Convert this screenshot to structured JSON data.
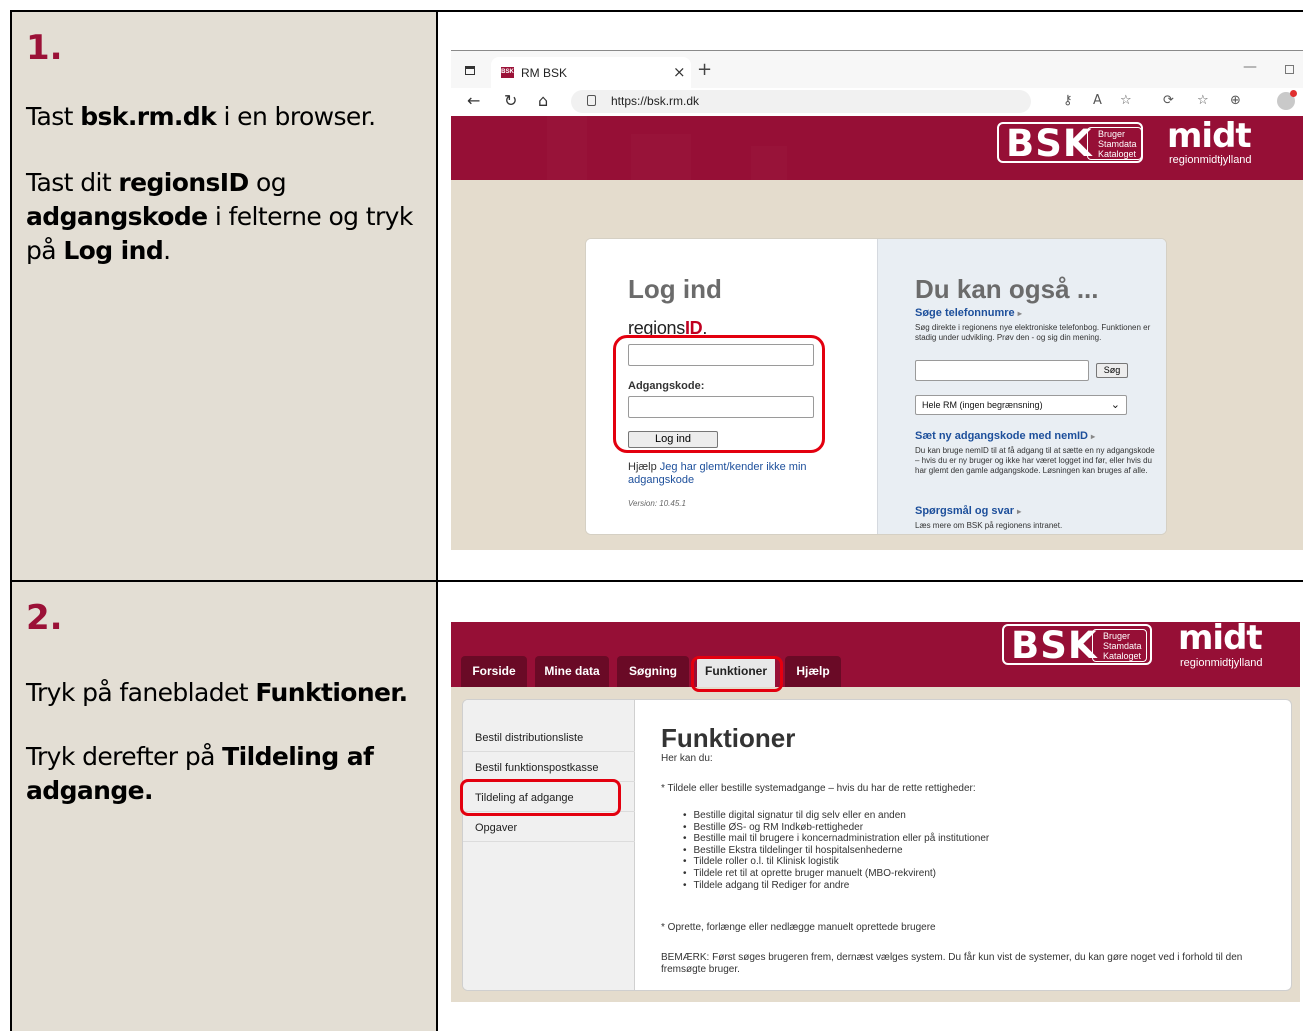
{
  "steps": [
    {
      "number": "1.",
      "paragraphs": [
        [
          {
            "t": "Tast "
          },
          {
            "t": "bsk.rm.dk",
            "b": true
          },
          {
            "t": " i en browser."
          }
        ],
        [
          {
            "t": "Tast dit "
          },
          {
            "t": "regionsID",
            "b": true
          },
          {
            "t": " og "
          },
          {
            "t": "adgangskode",
            "b": true
          },
          {
            "t": " i felterne og tryk på "
          },
          {
            "t": "Log ind",
            "b": true
          },
          {
            "t": "."
          }
        ]
      ]
    },
    {
      "number": "2.",
      "paragraphs": [
        [
          {
            "t": "Tryk på fanebladet "
          },
          {
            "t": "Funktioner.",
            "b": true
          }
        ],
        [
          {
            "t": "Tryk derefter på "
          },
          {
            "t": "Tildeling af adgange.",
            "b": true
          }
        ]
      ]
    }
  ],
  "browser": {
    "tab_title": "RM BSK",
    "favicon_text": "BSK",
    "url": "https://bsk.rm.dk",
    "close_glyph": "×",
    "newtab_glyph": "+",
    "minimize_glyph": "—"
  },
  "brand": {
    "bsk": "BSK",
    "bsk_sub": [
      "Bruger",
      "Stamdata",
      "Kataloget"
    ],
    "midt": "midt",
    "region": "regionmidtjylland",
    "colors": {
      "primary": "#960f36",
      "dark": "#6a0a26",
      "link": "#1d4f9b",
      "highlight": "#e3000f",
      "page_bg": "#e4dccd"
    }
  },
  "login": {
    "title": "Log ind",
    "regions_text": "regions",
    "regions_id": "ID",
    "regions_dot": ".",
    "password_label": "Adgangskode:",
    "button": "Log ind",
    "help_prefix": "Hjælp",
    "help_link": "Jeg har glemt/kender ikke min adgangskode",
    "version": "Version: 10.45.1"
  },
  "also": {
    "title": "Du kan også ...",
    "phone_link": "Søge telefonnumre",
    "phone_text": "Søg direkte i regionens nye elektroniske telefonbog. Funktionen er stadig under udvikling. Prøv den - og sig din mening.",
    "search_button": "Søg",
    "select_value": "Hele RM (ingen begrænsning)",
    "nemid_link": "Sæt ny adgangskode med nemID",
    "nemid_text": "Du kan bruge nemID til at få adgang til at sætte en ny adgangskode – hvis du er ny bruger og ikke har været logget ind før, eller hvis du har glemt den gamle adgangskode. Løsningen kan bruges af alle.",
    "faq_link": "Spørgsmål og svar",
    "faq_text": "Læs mere om BSK på regionens intranet."
  },
  "nav": {
    "tabs": [
      "Forside",
      "Mine data",
      "Søgning",
      "Funktioner",
      "Hjælp"
    ],
    "active": "Funktioner"
  },
  "sidebar": {
    "items": [
      "Bestil distributionsliste",
      "Bestil funktionspostkasse",
      "Tildeling af adgange",
      "Opgaver"
    ]
  },
  "funktioner": {
    "title": "Funktioner",
    "intro": "Her kan du:",
    "section1": "* Tildele eller bestille systemadgange – hvis du har de rette rettigheder:",
    "bullets": [
      "Bestille digital signatur til dig selv eller en anden",
      "Bestille ØS- og RM Indkøb-rettigheder",
      "Bestille mail til brugere i koncernadministration eller på institutioner",
      "Bestille Ekstra tildelinger til hospitalsenhederne",
      "Tildele roller o.l. til Klinisk logistik",
      "Tildele ret til at oprette bruger manuelt (MBO-rekvirent)",
      "Tildele adgang til Rediger for andre"
    ],
    "section2": "* Oprette, forlænge eller nedlægge manuelt oprettede brugere",
    "note": "BEMÆRK: Først søges brugeren frem, dernæst vælges system. Du får kun vist de systemer, du kan gøre noget ved i forhold til den fremsøgte bruger."
  },
  "icons": [
    "window-icon",
    "back-icon",
    "reload-icon",
    "home-icon",
    "lock-icon",
    "key-icon",
    "read-aloud-icon",
    "favorite-icon",
    "extensions-icon",
    "favorites-bar-icon",
    "collections-icon",
    "profile-icon",
    "dropdown-icon"
  ]
}
